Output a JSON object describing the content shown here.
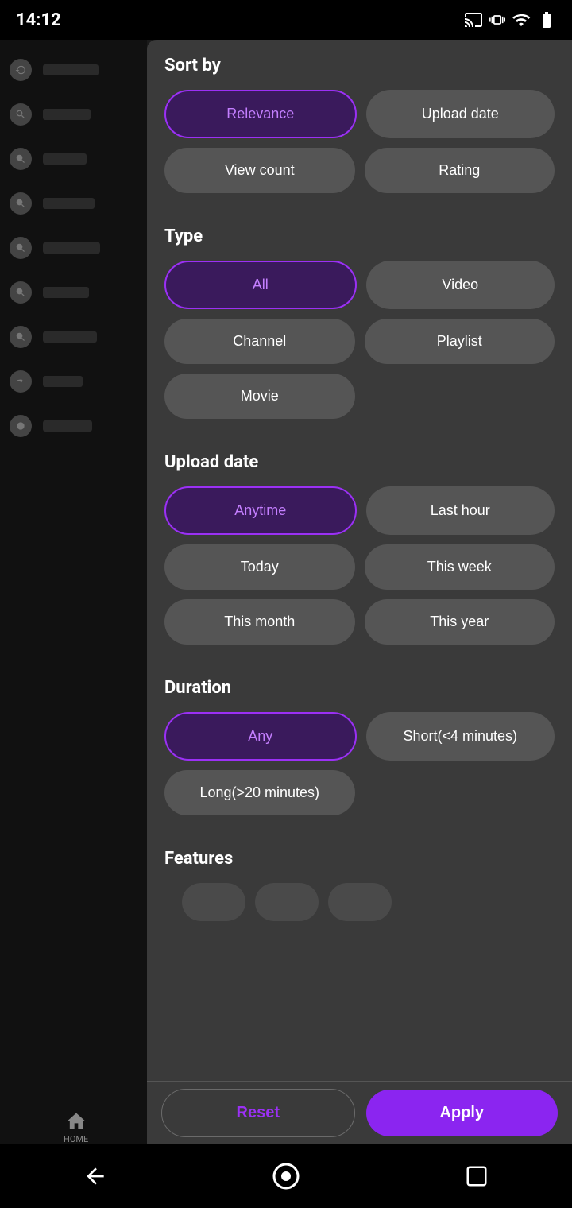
{
  "status_bar": {
    "time": "14:12",
    "icons": [
      "cast",
      "vibrate",
      "wifi",
      "battery"
    ]
  },
  "panel": {
    "sort_by": {
      "label": "Sort by",
      "options": [
        {
          "id": "relevance",
          "label": "Relevance",
          "selected": true
        },
        {
          "id": "upload_date",
          "label": "Upload date",
          "selected": false
        },
        {
          "id": "view_count",
          "label": "View count",
          "selected": false
        },
        {
          "id": "rating",
          "label": "Rating",
          "selected": false
        }
      ]
    },
    "type": {
      "label": "Type",
      "options": [
        {
          "id": "all",
          "label": "All",
          "selected": true
        },
        {
          "id": "video",
          "label": "Video",
          "selected": false
        },
        {
          "id": "channel",
          "label": "Channel",
          "selected": false
        },
        {
          "id": "playlist",
          "label": "Playlist",
          "selected": false
        },
        {
          "id": "movie",
          "label": "Movie",
          "selected": false
        }
      ]
    },
    "upload_date": {
      "label": "Upload date",
      "options": [
        {
          "id": "anytime",
          "label": "Anytime",
          "selected": true
        },
        {
          "id": "last_hour",
          "label": "Last hour",
          "selected": false
        },
        {
          "id": "today",
          "label": "Today",
          "selected": false
        },
        {
          "id": "this_week",
          "label": "This week",
          "selected": false
        },
        {
          "id": "this_month",
          "label": "This month",
          "selected": false
        },
        {
          "id": "this_year",
          "label": "This year",
          "selected": false
        }
      ]
    },
    "duration": {
      "label": "Duration",
      "options": [
        {
          "id": "any",
          "label": "Any",
          "selected": true
        },
        {
          "id": "short",
          "label": "Short(<4 minutes)",
          "selected": false
        },
        {
          "id": "long",
          "label": "Long(>20 minutes)",
          "selected": false
        }
      ]
    },
    "features": {
      "label": "Features"
    }
  },
  "actions": {
    "reset_label": "Reset",
    "apply_label": "Apply"
  },
  "nav": {
    "home_label": "HOME"
  }
}
